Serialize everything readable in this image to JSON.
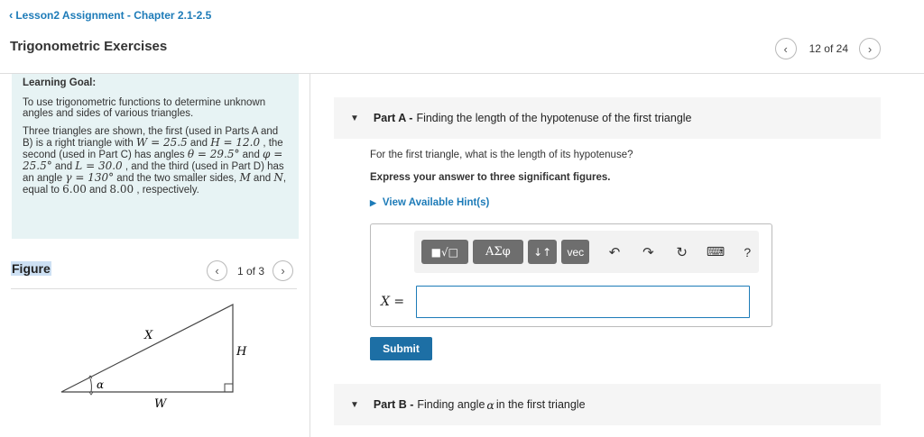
{
  "breadcrumb": {
    "label": "Lesson2 Assignment - Chapter 2.1-2.5"
  },
  "page_title": "Trigonometric Exercises",
  "nav": {
    "position": "12 of 24"
  },
  "learning_goal": {
    "heading": "Learning Goal:",
    "paragraph1": "To use trigonometric functions to determine unknown angles and sides of various triangles.",
    "p2": {
      "t1": "Three triangles are shown, the first (used in Parts A and B) is a right triangle with ",
      "m1": "W = 25.5",
      "t2": " and ",
      "m2": "H = 12.0",
      "t3": " , the second (used in Part C) has angles ",
      "m3": "θ = 29.5°",
      "t4": " and ",
      "m4": "φ = 25.5°",
      "t5": " and ",
      "m5": "L = 30.0",
      "t6": " , and the third (used in Part D) has an angle ",
      "m6": "γ = 130°",
      "t7": " and the two smaller sides, ",
      "m7": "M",
      "t8": " and ",
      "m8": "N",
      "t9": ", equal to ",
      "m9": "6.00",
      "t10": " and ",
      "m10": "8.00",
      "t11": " , respectively."
    }
  },
  "figure": {
    "heading": "Figure",
    "position": "1 of 3",
    "labels": {
      "x": "X",
      "h": "H",
      "w": "W",
      "alpha": "α"
    }
  },
  "part_a": {
    "label": "Part A -",
    "title": "Finding the length of the hypotenuse of the first triangle",
    "question": "For the first triangle, what is the length of its hypotenuse?",
    "instruction": "Express your answer to three significant figures.",
    "hint": "View Available Hint(s)",
    "toolbar": {
      "templates": "■√□",
      "greek": "ΑΣφ",
      "sort": "↓↑",
      "vec": "vec",
      "undo": "↶",
      "redo": "↷",
      "reset": "↻",
      "keyboard": "⌨",
      "help": "?"
    },
    "answer_label_var": "X",
    "answer_label_eq": " =",
    "answer_value": "",
    "submit": "Submit"
  },
  "part_b": {
    "label": "Part B -",
    "title_prefix": "Finding angle ",
    "title_var": "α",
    "title_suffix": " in the first triangle"
  },
  "colors": {
    "accent": "#1d7bb8",
    "goal_bg": "#e7f3f4",
    "submit_bg": "#1d6fa5"
  }
}
